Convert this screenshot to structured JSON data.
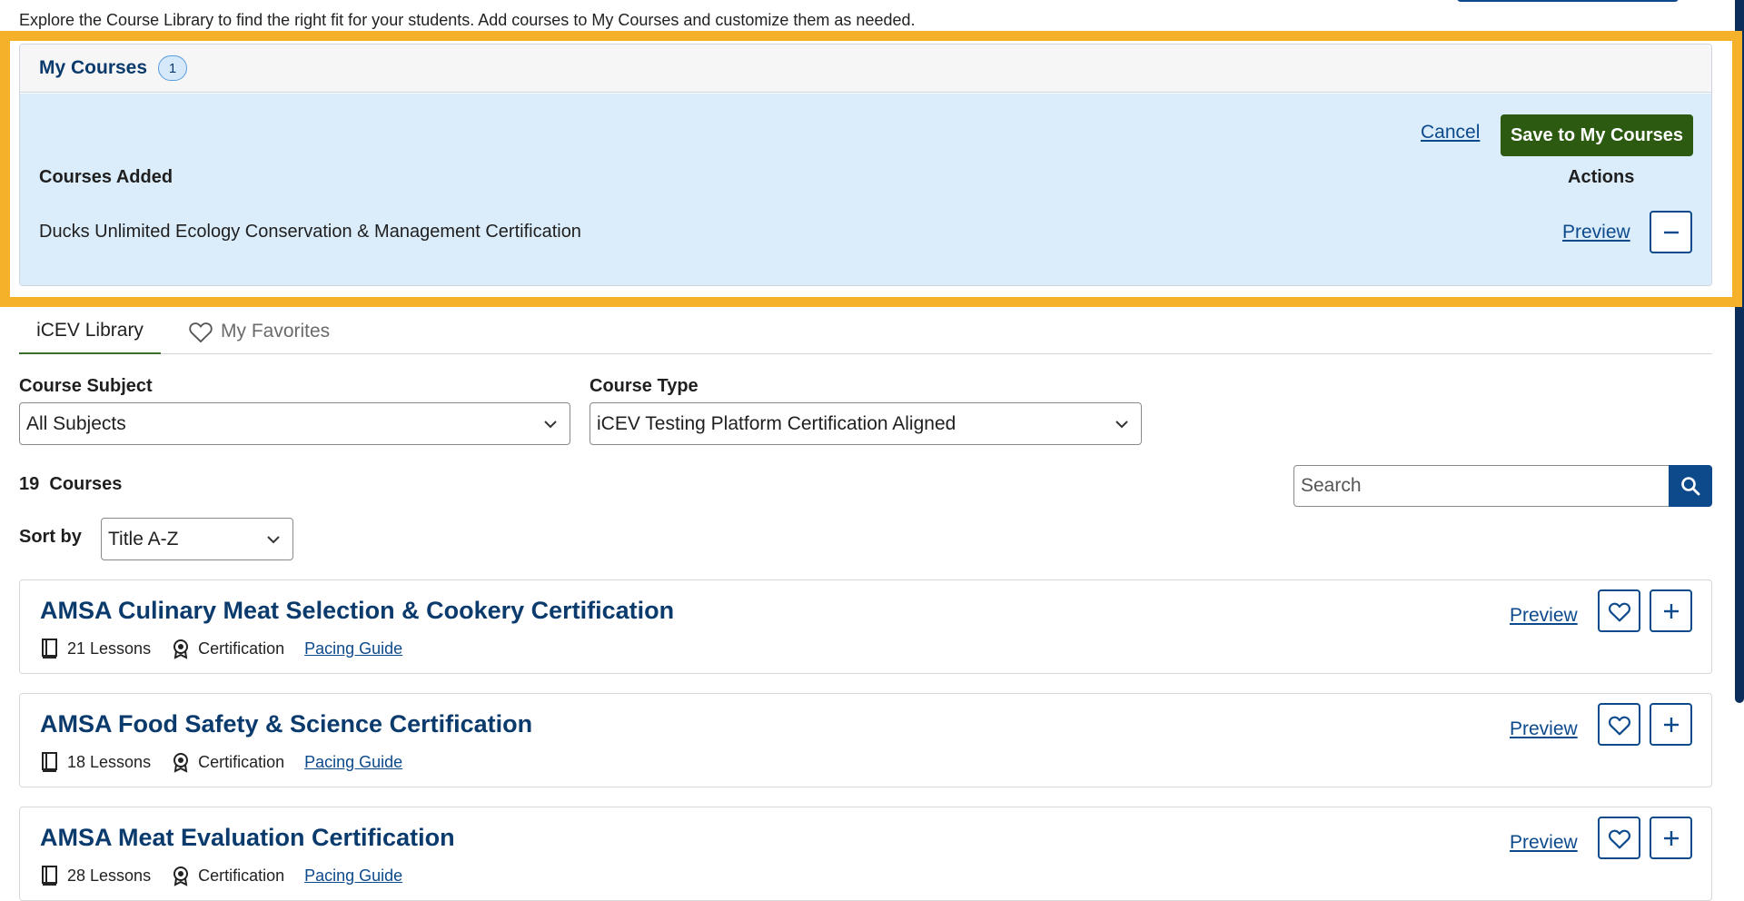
{
  "intro_text": "Explore the Course Library to find the right fit for your students. Add courses to My Courses and customize them as needed.",
  "my_courses": {
    "title": "My Courses",
    "count": "1",
    "cancel_label": "Cancel",
    "save_label": "Save to My Courses",
    "col_added": "Courses Added",
    "col_actions": "Actions",
    "added": [
      {
        "name": "Ducks Unlimited Ecology Conservation & Management Certification",
        "preview_label": "Preview"
      }
    ]
  },
  "tabs": [
    {
      "label": "iCEV Library",
      "active": true
    },
    {
      "label": "My Favorites",
      "active": false,
      "icon": "heart-outline-icon"
    }
  ],
  "filters": {
    "subject_label": "Course Subject",
    "subject_value": "All Subjects",
    "type_label": "Course Type",
    "type_value": "iCEV Testing Platform Certification Aligned"
  },
  "results": {
    "count": "19",
    "count_word": "Courses",
    "search_placeholder": "Search",
    "sort_label": "Sort by",
    "sort_value": "Title A-Z"
  },
  "courses": [
    {
      "title": "AMSA Culinary Meat Selection & Cookery Certification",
      "lessons": "21 Lessons",
      "type": "Certification",
      "pacing": "Pacing Guide",
      "preview": "Preview"
    },
    {
      "title": "AMSA Food Safety & Science Certification",
      "lessons": "18 Lessons",
      "type": "Certification",
      "pacing": "Pacing Guide",
      "preview": "Preview"
    },
    {
      "title": "AMSA Meat Evaluation Certification",
      "lessons": "28 Lessons",
      "type": "Certification",
      "pacing": "Pacing Guide",
      "preview": "Preview"
    }
  ],
  "colors": {
    "highlight": "#f5b12a",
    "navy": "#0b3a6d",
    "link": "#0d4a8c",
    "save_green": "#2b5a10",
    "panel_blue": "#dbecfb"
  }
}
